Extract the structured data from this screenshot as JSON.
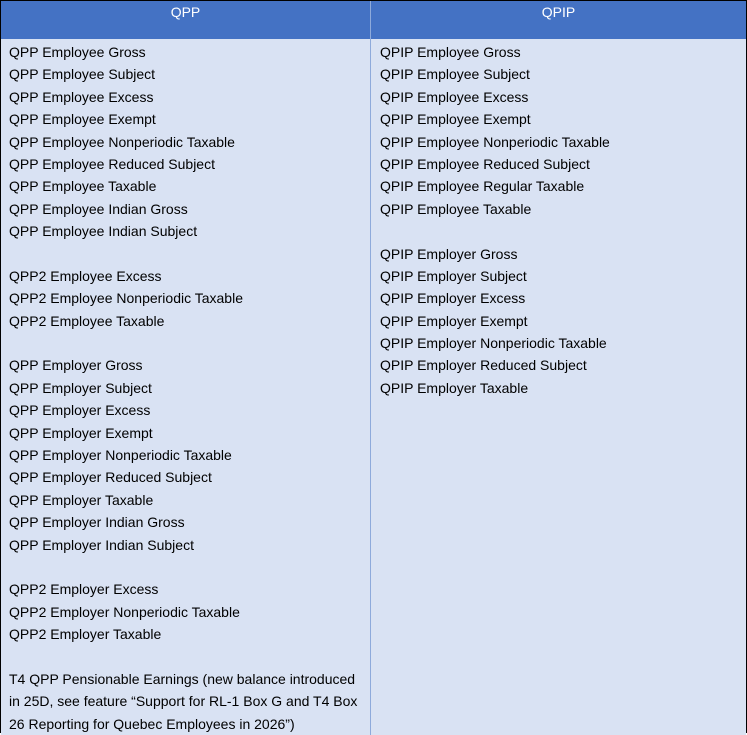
{
  "headers": {
    "qpp": "QPP",
    "qpip": "QPIP"
  },
  "qpp_items": [
    "QPP Employee Gross",
    "QPP Employee Subject",
    "QPP Employee Excess",
    "QPP Employee Exempt",
    "QPP Employee Nonperiodic Taxable",
    "QPP Employee Reduced Subject",
    "QPP Employee Taxable",
    "QPP Employee Indian Gross",
    "QPP Employee Indian Subject",
    "",
    "QPP2 Employee Excess",
    "QPP2 Employee Nonperiodic Taxable",
    "QPP2 Employee Taxable",
    "",
    "QPP Employer Gross",
    "QPP Employer Subject",
    "QPP Employer Excess",
    "QPP Employer Exempt",
    "QPP Employer Nonperiodic Taxable",
    "QPP Employer Reduced Subject",
    "QPP Employer Taxable",
    "QPP Employer Indian Gross",
    "QPP Employer Indian Subject",
    "",
    "QPP2 Employer Excess",
    "QPP2 Employer Nonperiodic Taxable",
    "QPP2 Employer Taxable",
    ""
  ],
  "qpp_note": "T4 QPP Pensionable Earnings (new balance introduced in 25D, see feature “Support for RL-1 Box G and T4 Box 26 Reporting for Quebec Employees in 2026”)",
  "qpip_items": [
    "QPIP Employee Gross",
    "QPIP Employee Subject",
    "QPIP Employee Excess",
    "QPIP Employee Exempt",
    "QPIP Employee Nonperiodic Taxable",
    "QPIP Employee Reduced Subject",
    "QPIP Employee Regular Taxable",
    "QPIP Employee Taxable",
    "",
    "QPIP Employer Gross",
    "QPIP Employer Subject",
    "QPIP Employer Excess",
    "QPIP Employer Exempt",
    "QPIP Employer Nonperiodic Taxable",
    "QPIP Employer Reduced Subject",
    "QPIP Employer Taxable"
  ]
}
